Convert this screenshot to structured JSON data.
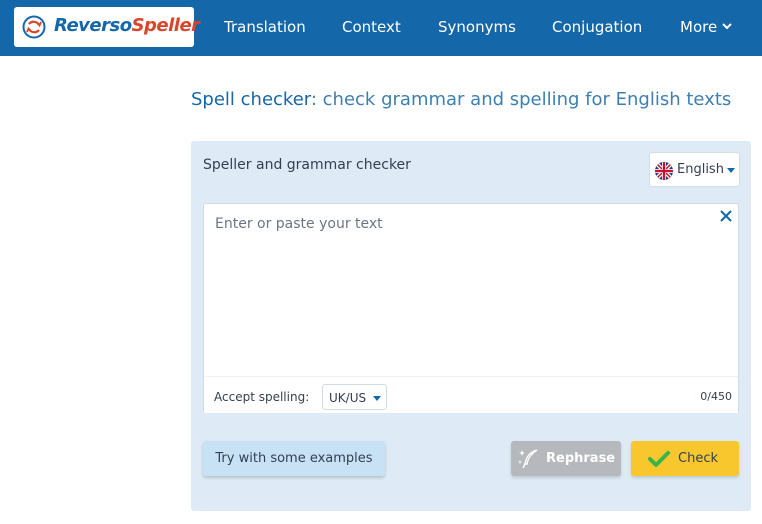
{
  "brand": {
    "part1": "Reverso",
    "part2": "Speller"
  },
  "nav": {
    "items": [
      {
        "label": "Translation"
      },
      {
        "label": "Context"
      },
      {
        "label": "Synonyms"
      },
      {
        "label": "Conjugation"
      },
      {
        "label": "More"
      }
    ]
  },
  "heading": {
    "strong": "Spell checker",
    "rest": ": check grammar and spelling for English texts"
  },
  "panel": {
    "title": "Speller and grammar checker",
    "language": "English"
  },
  "editor": {
    "placeholder": "Enter or paste your text",
    "accept_label": "Accept spelling:",
    "variant": "UK/US",
    "char_count": "0/450"
  },
  "actions": {
    "examples_label": "Try with some examples",
    "rephrase_label": "Rephrase",
    "check_label": "Check"
  },
  "icons": {
    "logo": "reverso-logo-icon",
    "more_chevron": "chevron-down-icon",
    "flag": "uk-flag-icon",
    "clear": "close-icon",
    "rephrase": "quill-sparkle-icon",
    "check": "checkmark-icon"
  },
  "colors": {
    "brand_blue": "#1467a8",
    "brand_red": "#d9462b",
    "panel_bg": "#deebf6",
    "check_yellow": "#f8c72d",
    "check_green": "#3bb54a"
  }
}
